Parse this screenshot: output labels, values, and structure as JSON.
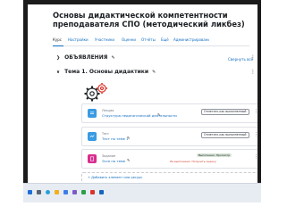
{
  "course": {
    "title": "Основы дидактической компетентности преподавателя СПО (методический ликбез)"
  },
  "tabs": [
    "Курс",
    "Настройки",
    "Участники",
    "Оценки",
    "Отчёты",
    "Ещё",
    "Администрирование"
  ],
  "sections": {
    "announcements": {
      "label": "ОБЪЯВЛЕНИЯ",
      "collapse_label": "Свернуть всё"
    },
    "topic1": {
      "label": "Тема 1. Основы дидактики"
    }
  },
  "activities": [
    {
      "type": "Лекция",
      "name": "Структура педагогической деятельности",
      "button": "Отметить как выполненный",
      "color": "#399be2"
    },
    {
      "type": "Тест",
      "name": "Тест по теме 1",
      "button": "Отметить как выполненный",
      "color": "#399be2"
    },
    {
      "type": "Задание",
      "name": "Эссе по теме",
      "badge_ok": "Выполнено: Просмотр",
      "badge_red": "Не выполнено: Получить оценку",
      "color": "#d82e8f"
    }
  ],
  "add_activity": {
    "label": "+ Добавить элемент или ресурс"
  },
  "colors": {
    "link": "#0f6cbf",
    "text": "#1d2125",
    "border": "#dee2e6"
  }
}
